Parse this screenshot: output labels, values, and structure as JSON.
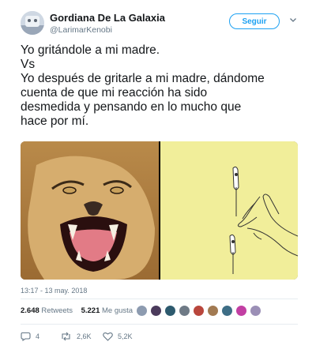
{
  "header": {
    "display_name": "Gordiana De La Galaxia",
    "handle": "@LarimarKenobi",
    "follow_label": "Seguir"
  },
  "tweet": {
    "lines": [
      "Yo gritándole a mi madre.",
      "Vs",
      "Yo después de gritarle a mi madre, dándome",
      "cuenta de que mi reacción ha sido",
      "desmedida y pensando en lo mucho que",
      "hace por mí."
    ],
    "timestamp": "13:17 - 13 may. 2018"
  },
  "stats": {
    "retweets_count": "2.648",
    "retweets_label": "Retweets",
    "likes_count": "5.221",
    "likes_label": "Me gusta"
  },
  "actions": {
    "replies": "4",
    "retweets": "2,6K",
    "likes": "5,2K"
  },
  "colors": {
    "accent": "#1da1f2",
    "secondary_text": "#657786",
    "drawing_background": "#f1ee9a"
  }
}
